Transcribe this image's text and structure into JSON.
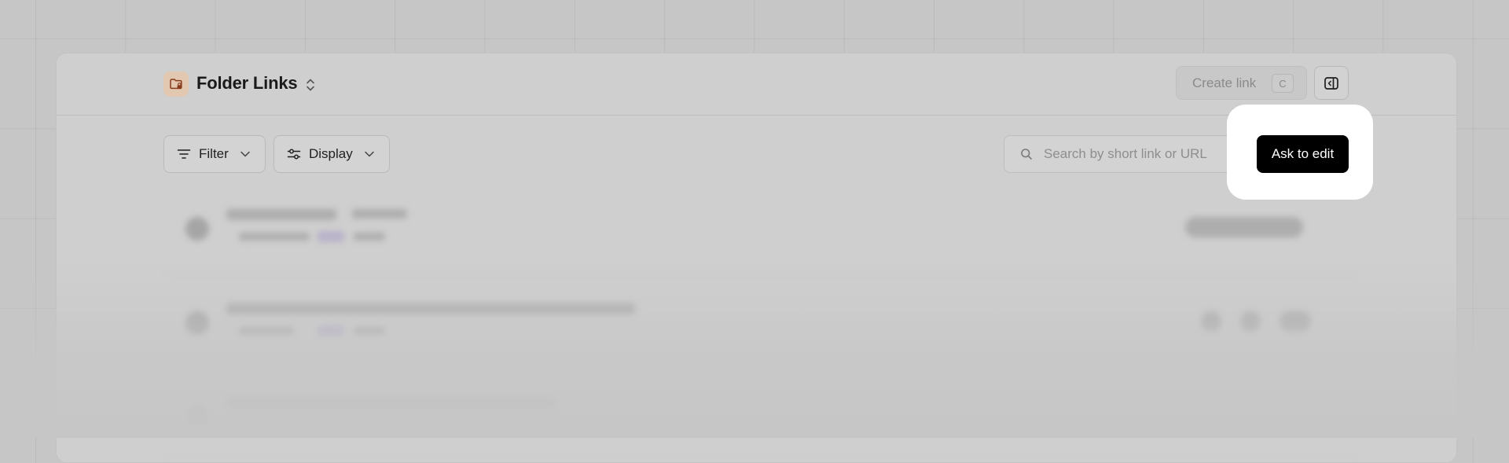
{
  "header": {
    "title": "Folder Links",
    "create_link_label": "Create link",
    "create_link_shortcut": "C"
  },
  "toolbar": {
    "filter_label": "Filter",
    "display_label": "Display"
  },
  "search": {
    "placeholder": "Search by short link or URL"
  },
  "cta": {
    "ask_to_edit_label": "Ask to edit"
  },
  "icons": {
    "folder": "folder-lock-icon",
    "switcher": "chevron-up-down-icon",
    "sidebar": "sidebar-toggle-icon",
    "filter": "filter-lines-icon",
    "display": "sliders-icon",
    "search": "search-icon"
  },
  "colors": {
    "accent": "#000000",
    "folder_badge": "#e2c8b1",
    "folder_icon": "#8a3b1c"
  }
}
